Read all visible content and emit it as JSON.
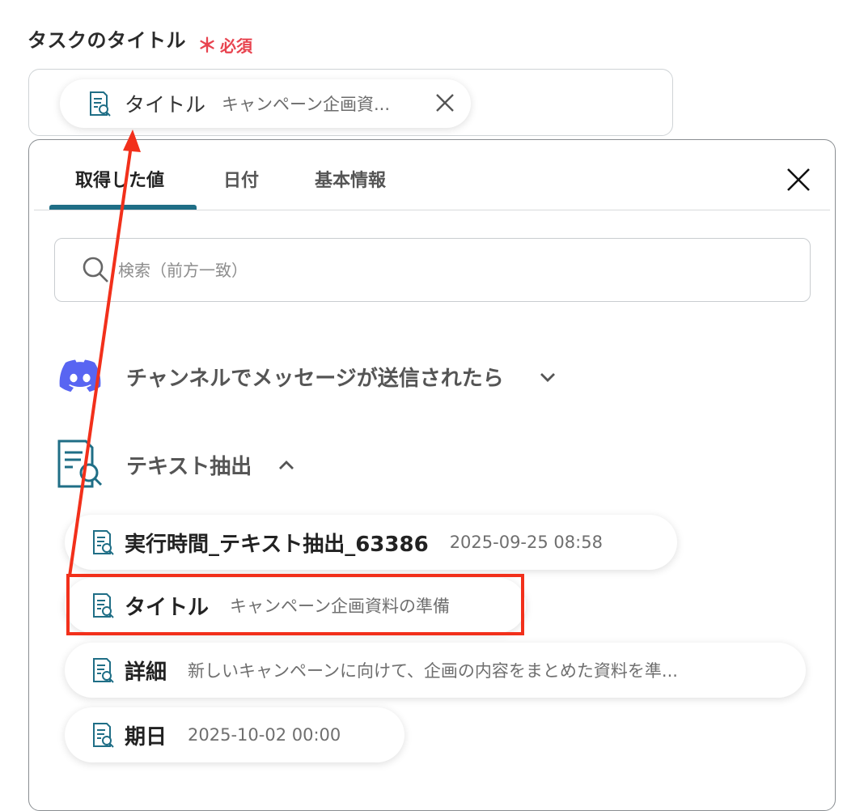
{
  "field": {
    "label": "タスクのタイトル",
    "required_mark": "＊",
    "required_text": "必須",
    "chip_label": "タイトル",
    "chip_value": "キャンペーン企画資..."
  },
  "panel": {
    "tabs": [
      {
        "label": "取得した値",
        "active": true
      },
      {
        "label": "日付",
        "active": false
      },
      {
        "label": "基本情報",
        "active": false
      }
    ],
    "search": {
      "placeholder": "検索（前方一致）",
      "value": ""
    },
    "sections": [
      {
        "title": "チャンネルでメッセージが送信されたら",
        "icon": "discord-icon",
        "expanded": false
      },
      {
        "title": "テキスト抽出",
        "icon": "document-search-icon",
        "expanded": true
      }
    ],
    "items": [
      {
        "label": "実行時間_テキスト抽出_63386",
        "value": "2025-09-25 08:58"
      },
      {
        "label": "タイトル",
        "value": "キャンペーン企画資料の準備"
      },
      {
        "label": "詳細",
        "value": "新しいキャンペーンに向けて、企画の内容をまとめた資料を準..."
      },
      {
        "label": "期日",
        "value": "2025-10-02 00:00"
      }
    ]
  },
  "colors": {
    "accent": "#1f6e86",
    "required": "#e8434f",
    "annotation": "#f2301b",
    "discord": "#5865f2"
  }
}
